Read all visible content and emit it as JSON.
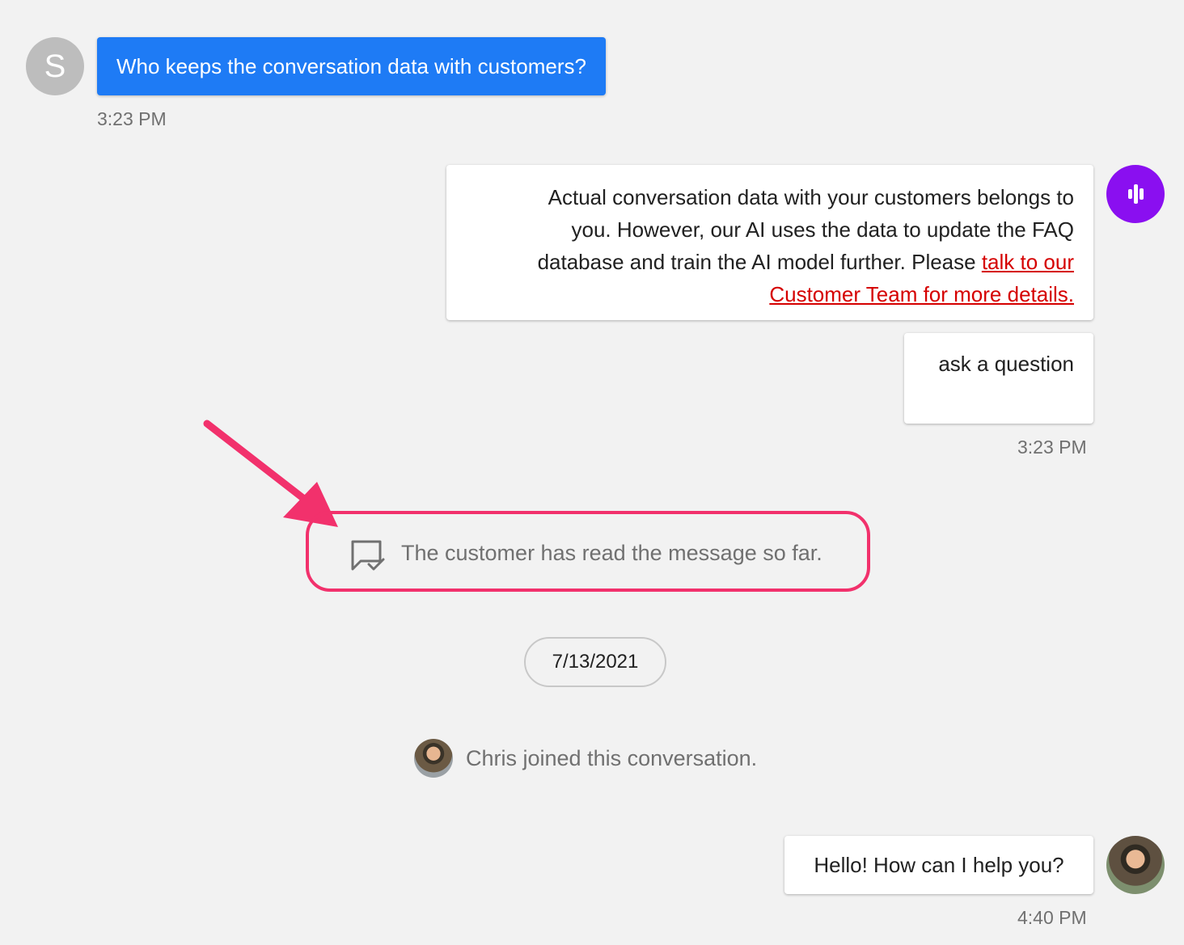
{
  "colors": {
    "customer_bubble": "#1e7bf5",
    "bot_avatar": "#8a0ff0",
    "link": "#d50000",
    "highlight": "#f2316c",
    "background": "#f2f2f2"
  },
  "customer_message": {
    "avatar_initial": "S",
    "text": "Who keeps the conversation data with customers?",
    "time": "3:23 PM"
  },
  "bot_messages": {
    "answer_line1": "Actual conversation data with your customers belongs to",
    "answer_line2": "you. However, our AI uses the data to update the FAQ",
    "answer_line3": "database and train the AI model further. Please ",
    "answer_link_part1": "talk to our",
    "answer_link_part2": "Customer Team for more details.",
    "button_text": "ask a question",
    "time": "3:23 PM",
    "avatar_icon": "sound-wave-icon"
  },
  "read_status": {
    "icon": "message-read-check-icon",
    "text": "The customer has read the message so far."
  },
  "date_divider": "7/13/2021",
  "system_event": {
    "text": "Chris joined this conversation."
  },
  "agent_message": {
    "text": "Hello! How can I help you?",
    "time": "4:40 PM"
  }
}
